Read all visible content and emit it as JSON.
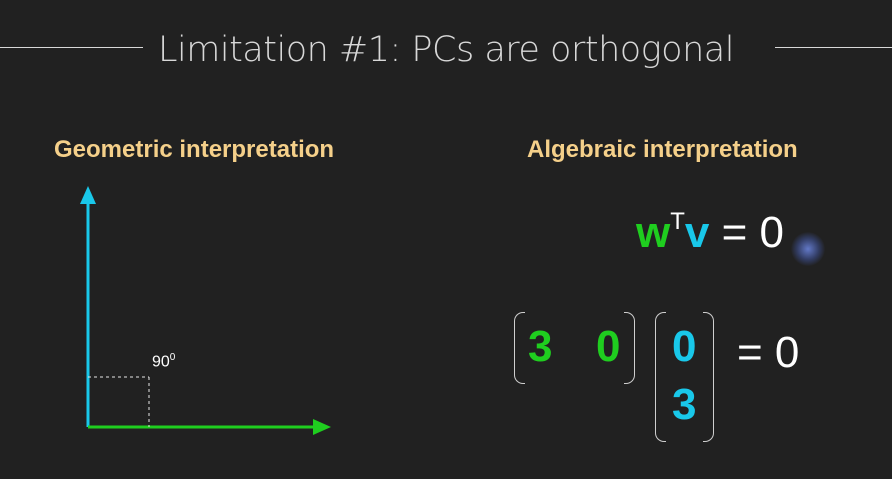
{
  "slide": {
    "title": "Limitation #1: PCs are orthogonal",
    "geometric": {
      "heading": "Geometric interpretation",
      "angle_value": "90",
      "angle_sup": "0"
    },
    "algebraic": {
      "heading": "Algebraic interpretation",
      "eq": {
        "w": "w",
        "sup": "T",
        "v": "v",
        "equals": "= 0"
      },
      "row_vector": [
        "3",
        "0"
      ],
      "col_vector": [
        "0",
        "3"
      ],
      "matrix_equals": "= 0"
    }
  },
  "colors": {
    "background": "#212121",
    "heading": "#f5d08a",
    "green": "#1fce1f",
    "cyan": "#19c8ea",
    "text": "#d8d8d8"
  }
}
